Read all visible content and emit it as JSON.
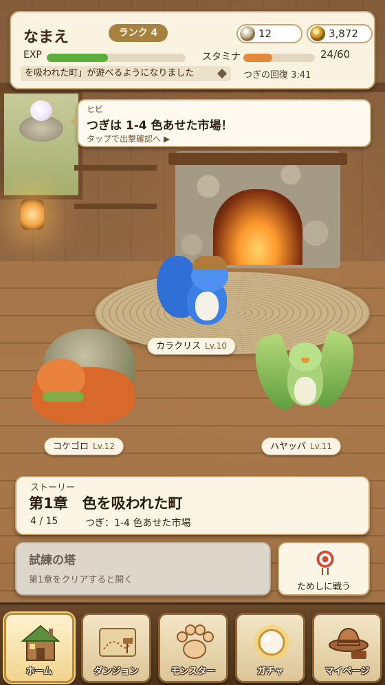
{
  "player": {
    "name": "なまえ",
    "rank": "ランク 4",
    "gems": "12",
    "gold": "3,872",
    "exp_label": "EXP",
    "exp_fill": 0.44,
    "stamina_label": "スタミナ",
    "stamina_value": "24/60",
    "stamina_fill": 0.4,
    "ticker": "を吸われた町」が遊べるようになりました",
    "recovery": "つぎの回復 3:41"
  },
  "guide": {
    "speaker": "ヒビ",
    "message": "つぎは 1-4 色あせた市場！",
    "hint": "タップで出撃確認へ ▶"
  },
  "monsters": [
    {
      "name": "カラクリス",
      "level": "Lv.10"
    },
    {
      "name": "コケゴロ",
      "level": "Lv.12"
    },
    {
      "name": "ハヤッパ",
      "level": "Lv.11"
    }
  ],
  "story": {
    "tag": "ストーリー",
    "title": "第1章　色を吸われた町",
    "progress": "4 / 15",
    "next": "つぎ：1-4 色あせた市場"
  },
  "tower": {
    "title": "試練の塔",
    "description": "第1章をクリアすると開く"
  },
  "trial": {
    "label": "ためしに戦う"
  },
  "nav": [
    {
      "label": "ホーム",
      "icon": "house-icon",
      "active": true
    },
    {
      "label": "ダンジョン",
      "icon": "map-icon",
      "active": false
    },
    {
      "label": "モンスター",
      "icon": "paw-icon",
      "active": false
    },
    {
      "label": "ガチャ",
      "icon": "orb-icon",
      "active": false
    },
    {
      "label": "マイページ",
      "icon": "hat-icon",
      "active": false
    }
  ],
  "colors": {
    "exp_bar": "#5aae3c",
    "stamina_bar": "#e3893a",
    "panel_bg": "#fbf3e1",
    "panel_border": "#c9a873"
  }
}
